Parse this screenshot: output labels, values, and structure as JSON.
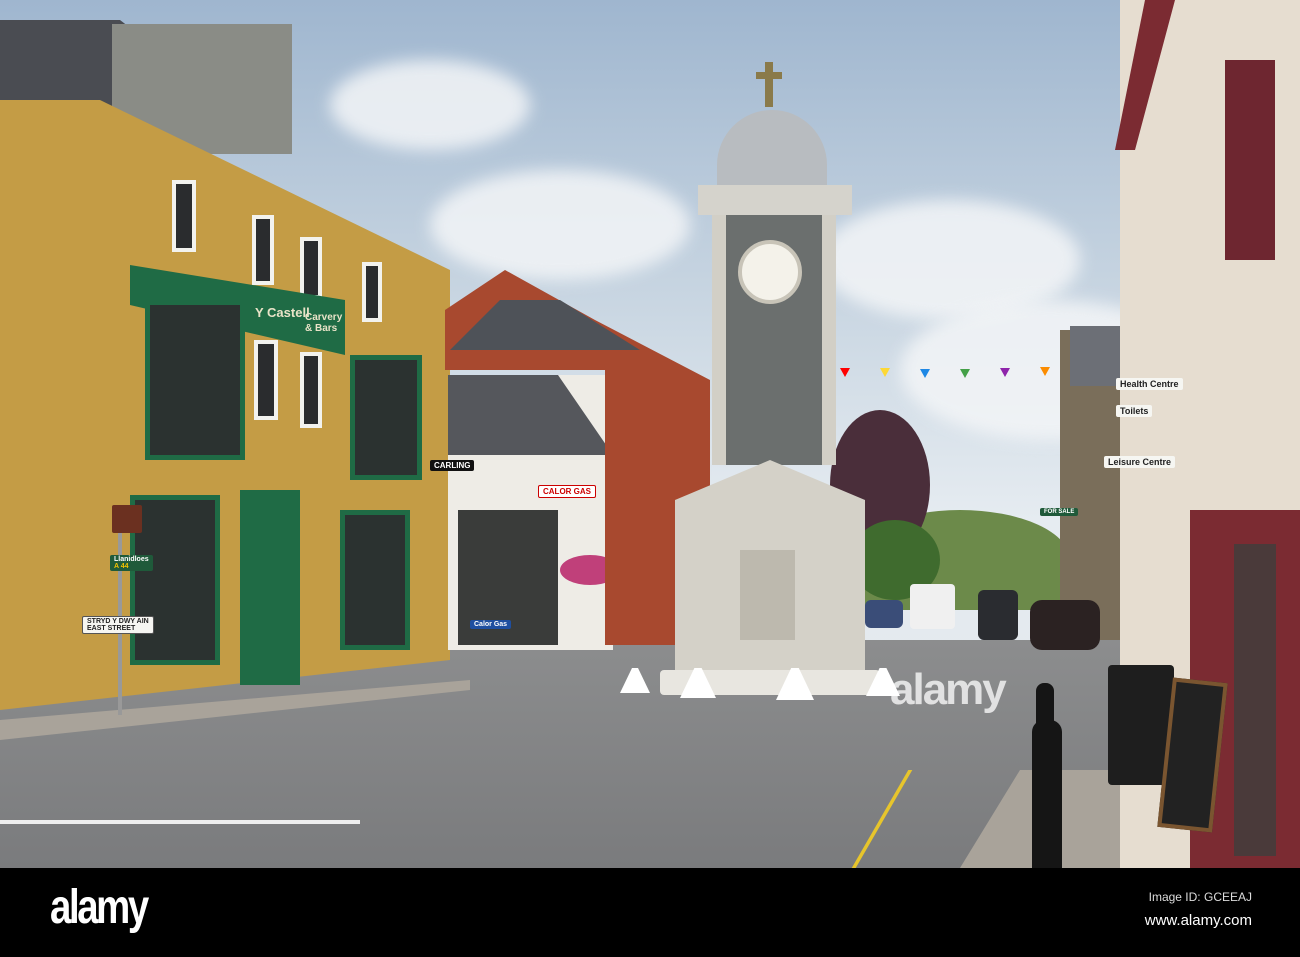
{
  "scene": {
    "description_labels": {
      "pub_sign": "Y Castell",
      "pub_sign_2": "Carvery & Bars",
      "carling_sign": "CARLING",
      "calor_sign": "CALOR GAS",
      "calor_sign_2": "Calor Gas",
      "street_sign_welsh": "STRYD Y DWY AIN",
      "street_sign_english": "EAST STREET",
      "direction_sign": "Llanidloes",
      "direction_sign_road": "A 44",
      "health_centre_sign": "Health Centre",
      "toilets_sign": "Toilets",
      "leisure_centre_sign": "Leisure Centre",
      "for_sale_sign": "FOR SALE"
    }
  },
  "watermark": {
    "logo": "alamy",
    "image_id": "Image ID: GCEEAJ",
    "url": "www.alamy.com",
    "center_logo": "alamy"
  },
  "colors": {
    "pub_green": "#1f6b45",
    "ochre": "#c9a24a",
    "bunting": [
      "#e53935",
      "#fdd835",
      "#1e88e5",
      "#43a047",
      "#8e24aa",
      "#fb8c00"
    ]
  }
}
